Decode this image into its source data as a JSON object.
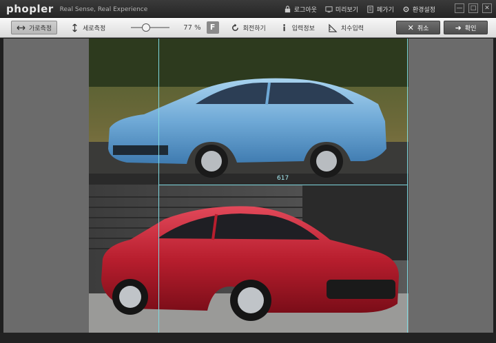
{
  "app": {
    "logo": "phopler",
    "tagline": "Real Sense, Real Experience"
  },
  "menu": {
    "logout": "로그아웃",
    "preview": "미리보기",
    "close": "페가기",
    "settings": "환경설정"
  },
  "window": {
    "minimize": "—",
    "maximize": "□",
    "close": "✕"
  },
  "toolbar": {
    "horizontal_measure": "가로측정",
    "vertical_measure": "세로측정",
    "zoom": "77 %",
    "fit": "F",
    "rotate": "회전하기",
    "input_info": "입력정보",
    "dimension_input": "치수입력",
    "cancel": "취소",
    "confirm": "확인"
  },
  "canvas": {
    "measurement": "617"
  }
}
